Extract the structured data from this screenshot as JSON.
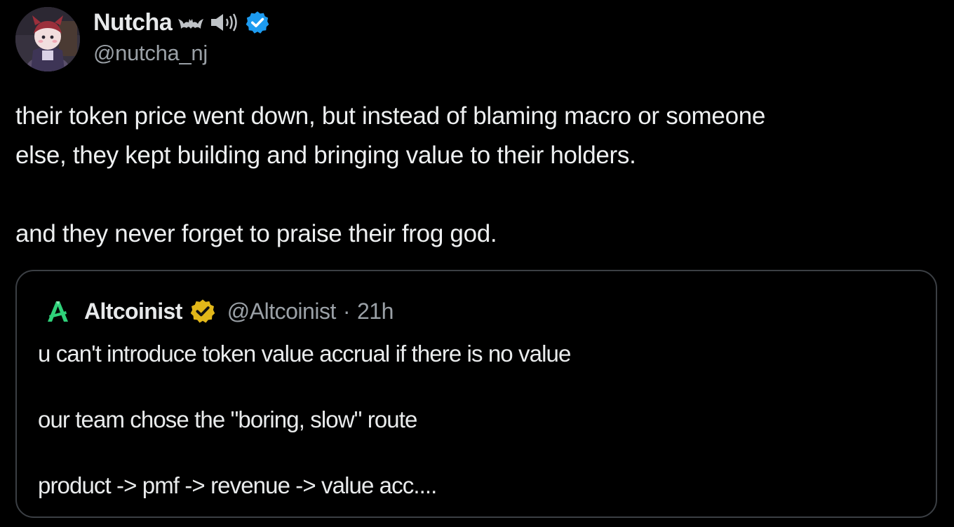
{
  "post": {
    "author": {
      "name": "Nutcha",
      "handle": "@nutcha_nj",
      "name_emojis": [
        "bat-icon",
        "speaker-icon"
      ],
      "verified": true,
      "verified_color": "#1d9bf0"
    },
    "text": {
      "paragraph_1_line_1": "their token price went down, but instead of blaming macro or someone",
      "paragraph_1_line_2": "else, they kept building and bringing value to their holders.",
      "paragraph_2": "and they never forget to praise their frog god."
    }
  },
  "quoted_post": {
    "author": {
      "name": "Altcoinist",
      "handle": "@Altcoinist",
      "verified": true,
      "verified_color": "#e2b719",
      "logo_color": "#2fd17a"
    },
    "separator": "·",
    "timestamp": "21h",
    "lines": [
      "u can't introduce token value accrual if there is no value",
      "our team chose the \"boring, slow\" route",
      "product -> pmf -> revenue -> value acc...."
    ]
  },
  "colors": {
    "background": "#000000",
    "text_primary": "#e7e9ea",
    "text_secondary": "#9aa0a6",
    "border": "#3b3f44"
  }
}
